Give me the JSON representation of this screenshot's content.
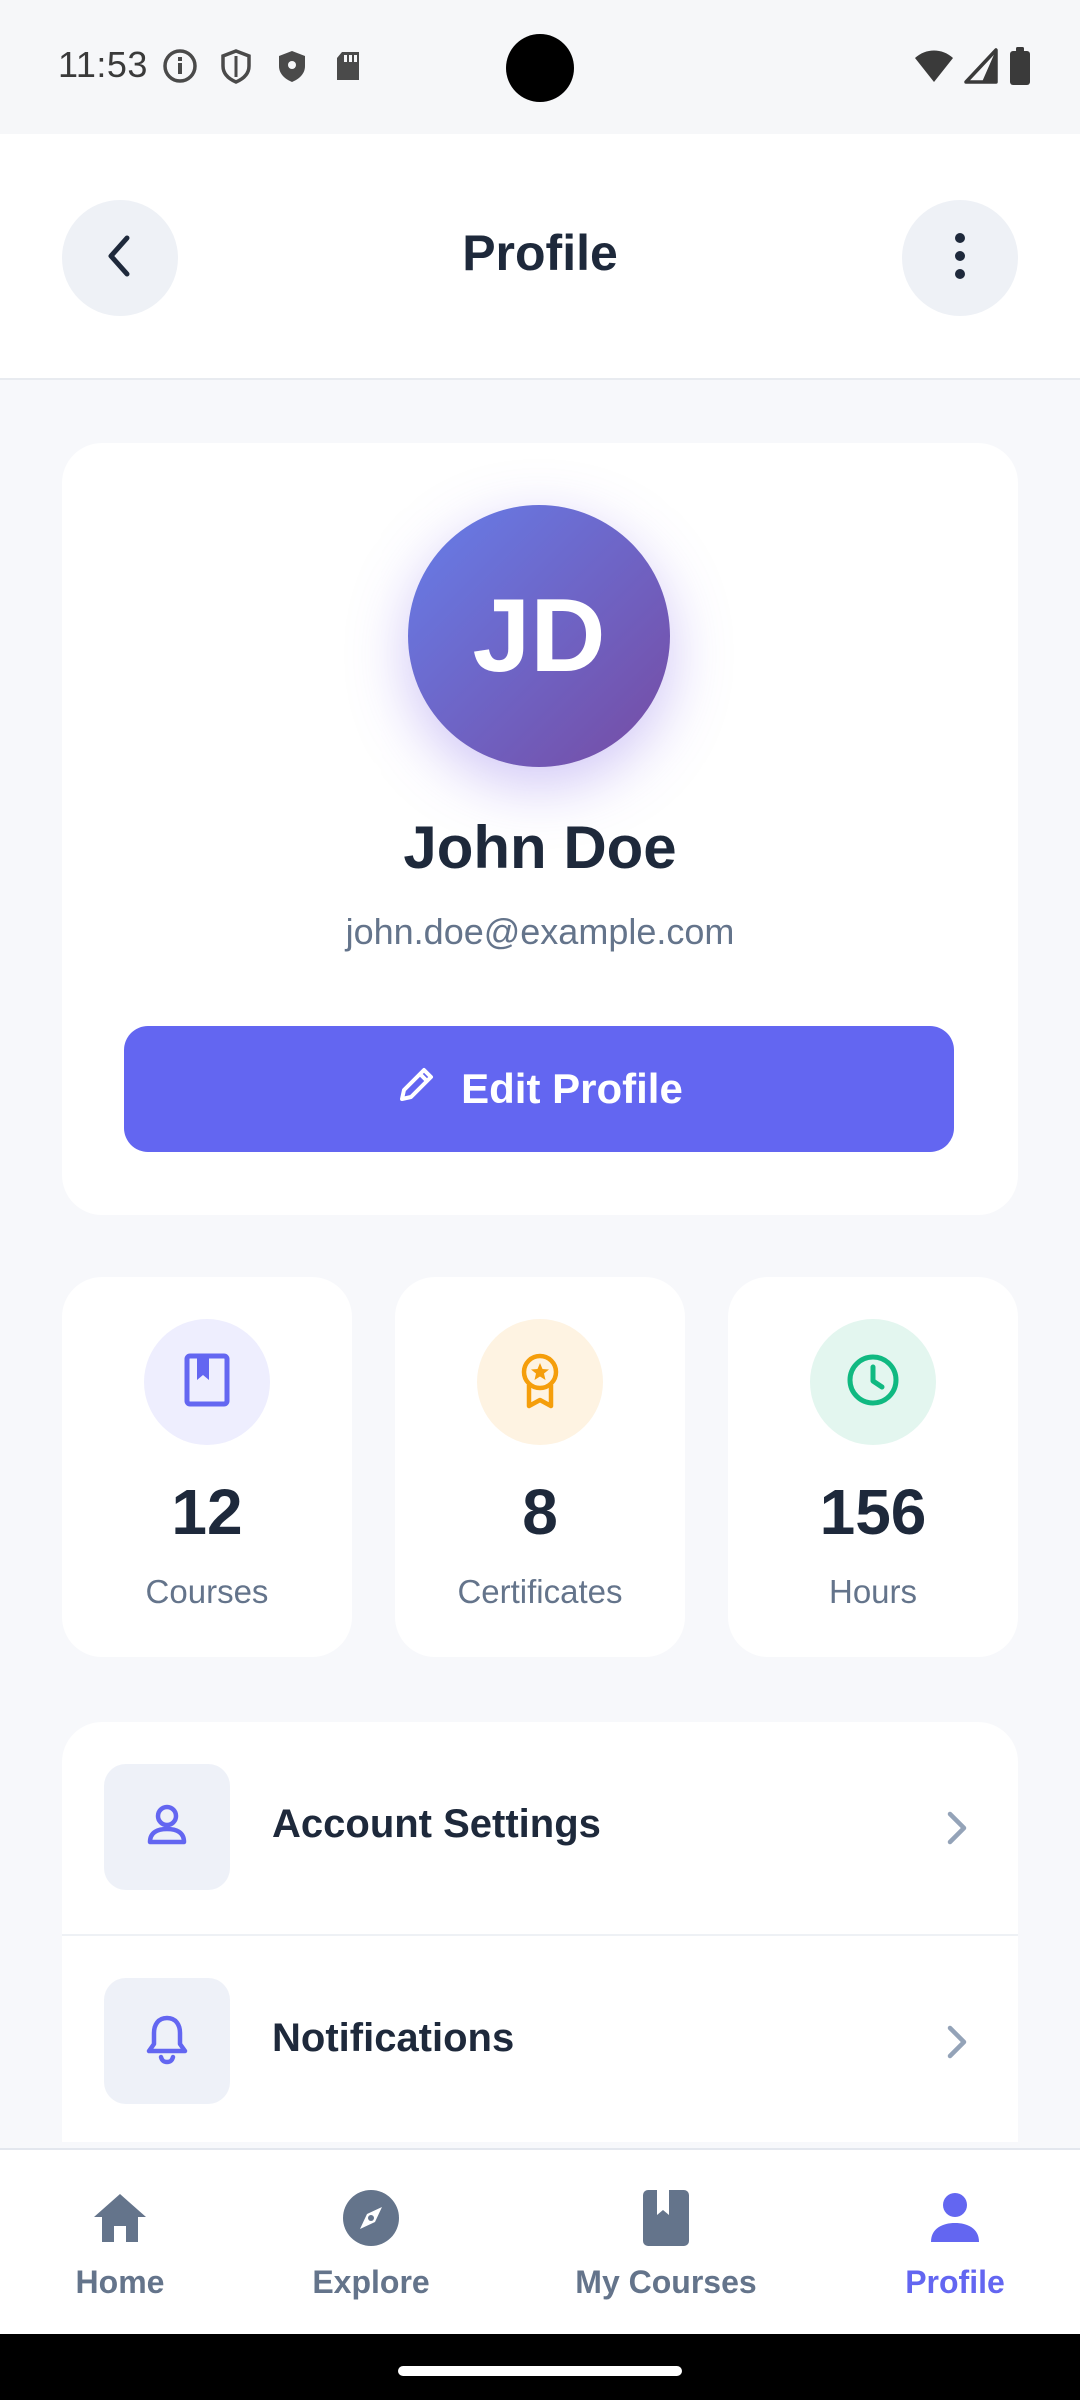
{
  "status_bar": {
    "time": "11:53",
    "left_icons": [
      "info-icon",
      "shield-outline-icon",
      "shield-filled-icon",
      "sd-card-icon"
    ],
    "right_icons": [
      "wifi-icon",
      "signal-icon",
      "battery-icon"
    ]
  },
  "app_bar": {
    "title": "Profile",
    "back_icon": "chevron-left-icon",
    "more_icon": "more-vertical-icon"
  },
  "profile": {
    "initials": "JD",
    "name": "John Doe",
    "email": "john.doe@example.com",
    "edit_label": "Edit Profile",
    "avatar_gradient": [
      "#667EEA",
      "#764BA2"
    ],
    "accent": "#6366F1"
  },
  "stats": [
    {
      "value": "12",
      "label": "Courses",
      "icon": "book-icon",
      "color": "#6366F1",
      "bg": "#EEEEFE"
    },
    {
      "value": "8",
      "label": "Certificates",
      "icon": "award-icon",
      "color": "#F59E0B",
      "bg": "#FEF3E2"
    },
    {
      "value": "156",
      "label": "Hours",
      "icon": "clock-icon",
      "color": "#10B981",
      "bg": "#E3F6EF"
    }
  ],
  "menu": [
    {
      "label": "Account Settings",
      "icon": "person-icon"
    },
    {
      "label": "Notifications",
      "icon": "bell-icon"
    }
  ],
  "bottom_nav": [
    {
      "label": "Home",
      "icon": "home-icon",
      "active": false
    },
    {
      "label": "Explore",
      "icon": "compass-icon",
      "active": false
    },
    {
      "label": "My Courses",
      "icon": "book-icon",
      "active": false
    },
    {
      "label": "Profile",
      "icon": "person-icon",
      "active": true
    }
  ]
}
